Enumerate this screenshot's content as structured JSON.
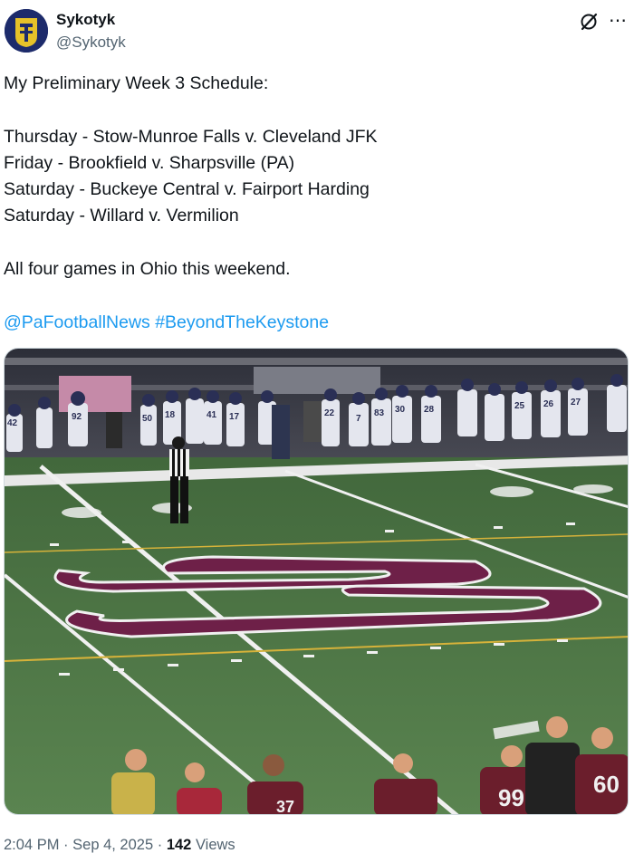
{
  "author": {
    "name": "Sykotyk",
    "handle": "@Sykotyk",
    "avatar_icon": "helmet-logo-icon",
    "avatar_colors": {
      "bg": "#1d2b6b",
      "helmet": "#e6c229"
    }
  },
  "header_icons": {
    "grok": "grok-icon",
    "more": "more-dots-icon"
  },
  "tweet": {
    "lines": [
      "My Preliminary Week 3 Schedule:",
      "",
      "Thursday - Stow-Munroe Falls v. Cleveland JFK",
      "Friday - Brookfield v. Sharpsville (PA)",
      "Saturday - Buckeye Central v. Fairport Harding",
      "Saturday - Willard v. Vermilion",
      "",
      "All four games in Ohio this weekend.",
      ""
    ],
    "mentions": [
      "@PaFootballNews",
      "#BeyondTheKeystone"
    ]
  },
  "photo": {
    "subject": "football-field-photo",
    "field_logo": "S",
    "visible_jersey_numbers": [
      "42",
      "92",
      "50",
      "18",
      "41",
      "17",
      "22",
      "7",
      "83",
      "30",
      "28",
      "25",
      "26",
      "27",
      "99",
      "60",
      "37"
    ],
    "colors": {
      "field": "#4f7a47",
      "logo": "#6e2048",
      "stands": "#3a3d4a",
      "maroon": "#6b1e2c"
    }
  },
  "meta": {
    "time": "2:04 PM",
    "date": "Sep 4, 2025",
    "views_count": "142",
    "views_label": "Views",
    "separator": "·"
  }
}
